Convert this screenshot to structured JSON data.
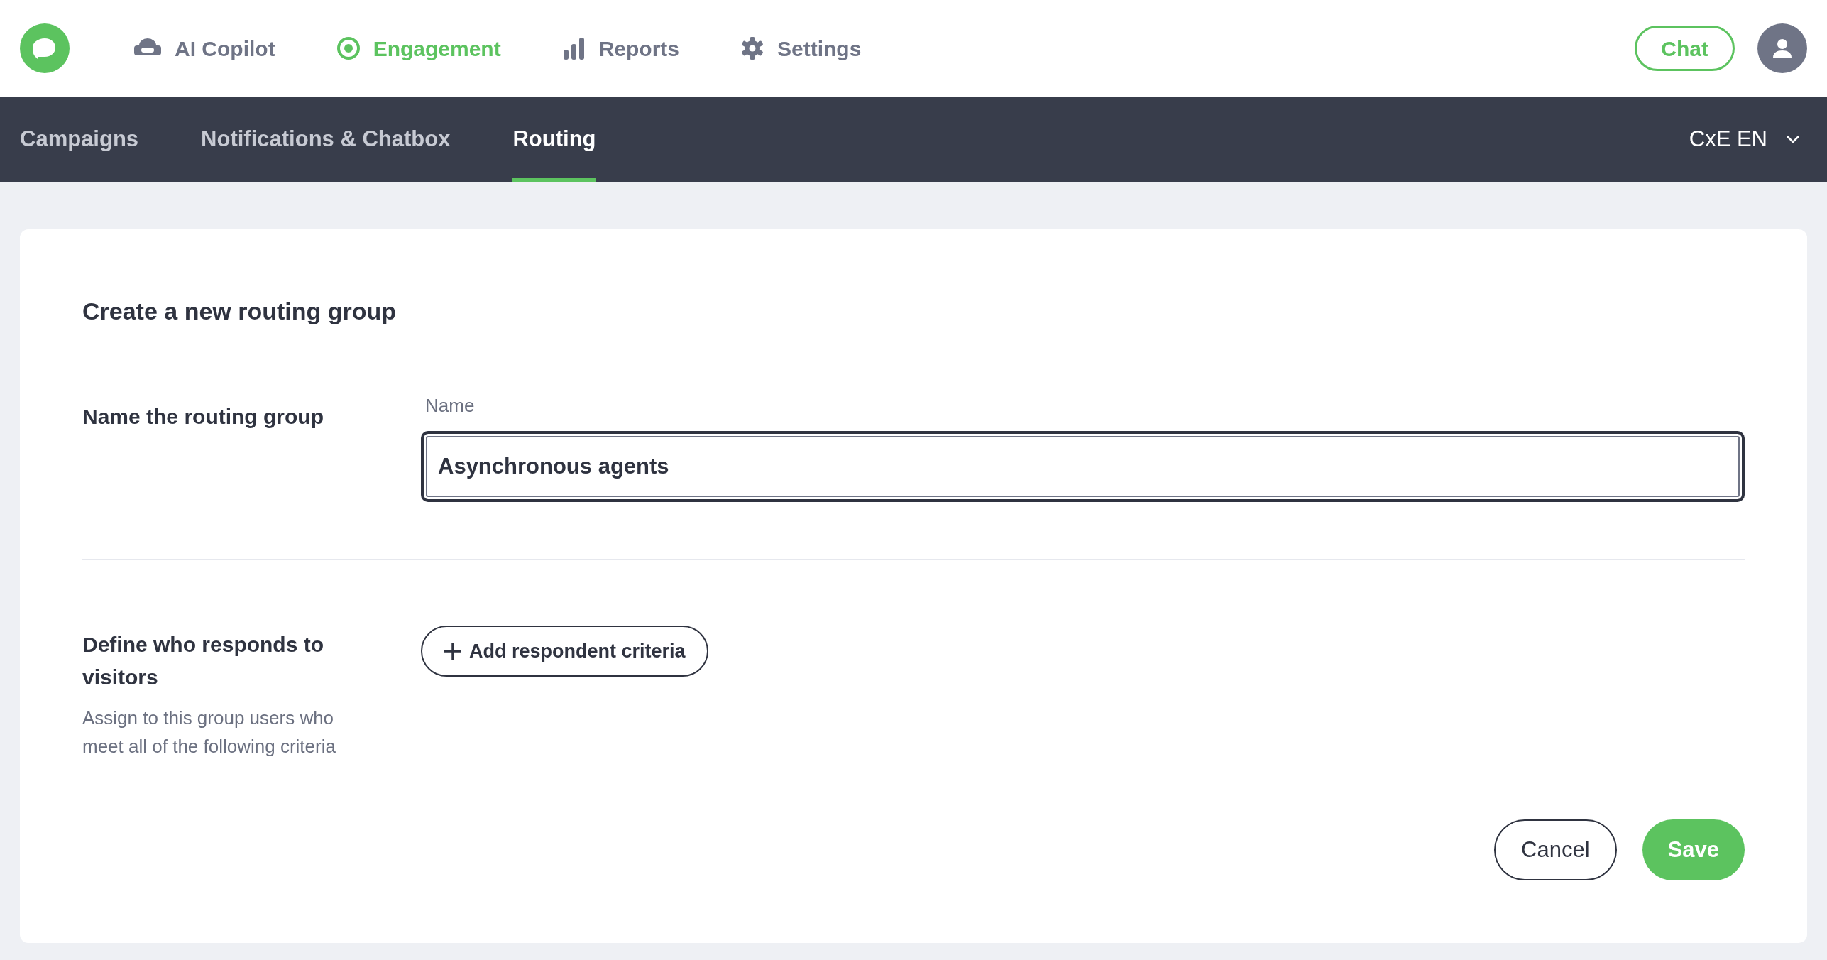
{
  "nav": [
    {
      "kind": "copilot",
      "label": "AI Copilot",
      "selected": false
    },
    {
      "kind": "engagement",
      "label": "Engagement",
      "selected": true
    },
    {
      "kind": "reports",
      "label": "Reports",
      "selected": false
    },
    {
      "kind": "settings",
      "label": "Settings",
      "selected": false
    }
  ],
  "chat_button": "Chat",
  "subnav": {
    "tabs": [
      {
        "label": "Campaigns",
        "selected": false
      },
      {
        "label": "Notifications & Chatbox",
        "selected": false
      },
      {
        "label": "Routing",
        "selected": true
      }
    ],
    "workspace": "CxE EN"
  },
  "form": {
    "title": "Create a new routing group",
    "name_section": {
      "heading": "Name the routing group",
      "field_label": "Name",
      "value": "Asynchronous agents",
      "focused": true
    },
    "respondents_section": {
      "heading": "Define who responds to visitors",
      "description": "Assign to this group users who meet all of the following criteria",
      "add_button": "Add respondent criteria"
    },
    "buttons": {
      "cancel": "Cancel",
      "save": "Save"
    }
  }
}
